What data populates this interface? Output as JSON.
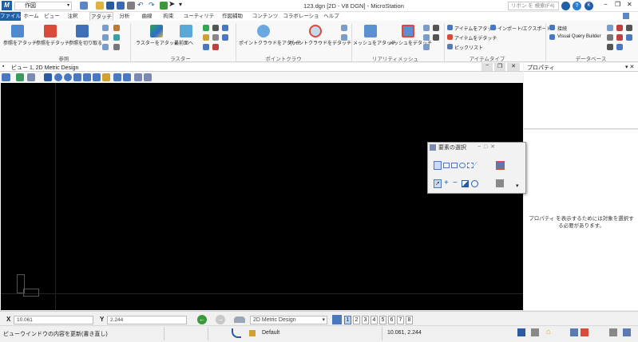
{
  "app": {
    "title": "123.dgn [2D - V8 DGN] - MicroStation",
    "logo": "M",
    "workflow": "作図",
    "search_placeholder": "リボン を 検索(F4)",
    "accent": "#1f5ea8",
    "window_controls": {
      "minimize": "−",
      "restore": "❐",
      "close": "✕"
    }
  },
  "tabs": [
    "ファイル",
    "ホーム",
    "ビュー",
    "注釈",
    "アタッチ",
    "分析",
    "曲線",
    "拘束",
    "ユーティリティ",
    "作図補助",
    "コンテンツ",
    "コラボレーション",
    "ヘルプ"
  ],
  "ribbon": {
    "groups": [
      {
        "label": "参照",
        "buttons": [
          "参照をアタッチ",
          "参照をデタッチ",
          "参照を切り取る"
        ]
      },
      {
        "label": "ラスター",
        "buttons": [
          "ラスターをアタッチ",
          "最前面へ"
        ]
      },
      {
        "label": "ポイントクラウド",
        "buttons": [
          "ポイントクラウドをアタッチ",
          "ポイントクラウドをデタッチ"
        ]
      },
      {
        "label": "リアリティメッシュ",
        "buttons": [
          "メッシュをアタッチ",
          "メッシュをデタッチ"
        ]
      },
      {
        "label": "アイテムタイプ",
        "buttons": [
          "アイテムをアタッチ",
          "アイテムをデタッチ",
          "ピックリスト",
          "インポート/エクスポート"
        ]
      },
      {
        "label": "データベース",
        "buttons": [
          "接続",
          "Visual Query Builder"
        ]
      }
    ]
  },
  "view": {
    "title": "ビュー 1, 2D Metric Design"
  },
  "properties": {
    "title": "プロパティ",
    "empty_message": "プロパティ を表示するためには対象を選択する必要があります。",
    "controls": "▾ ✕"
  },
  "select_dialog": {
    "title": "要素の選択",
    "controls": "−  □  ✕"
  },
  "status": {
    "x_label": "X",
    "x_value": "10.061",
    "y_label": "Y",
    "y_value": "2.244",
    "model": "2D Metric Design",
    "views": [
      "1",
      "2",
      "3",
      "4",
      "5",
      "6",
      "7",
      "8"
    ],
    "message": "ビューウインドウの内容を更新(書き直し)",
    "level": "Default",
    "coords": "10.061, 2.244"
  }
}
